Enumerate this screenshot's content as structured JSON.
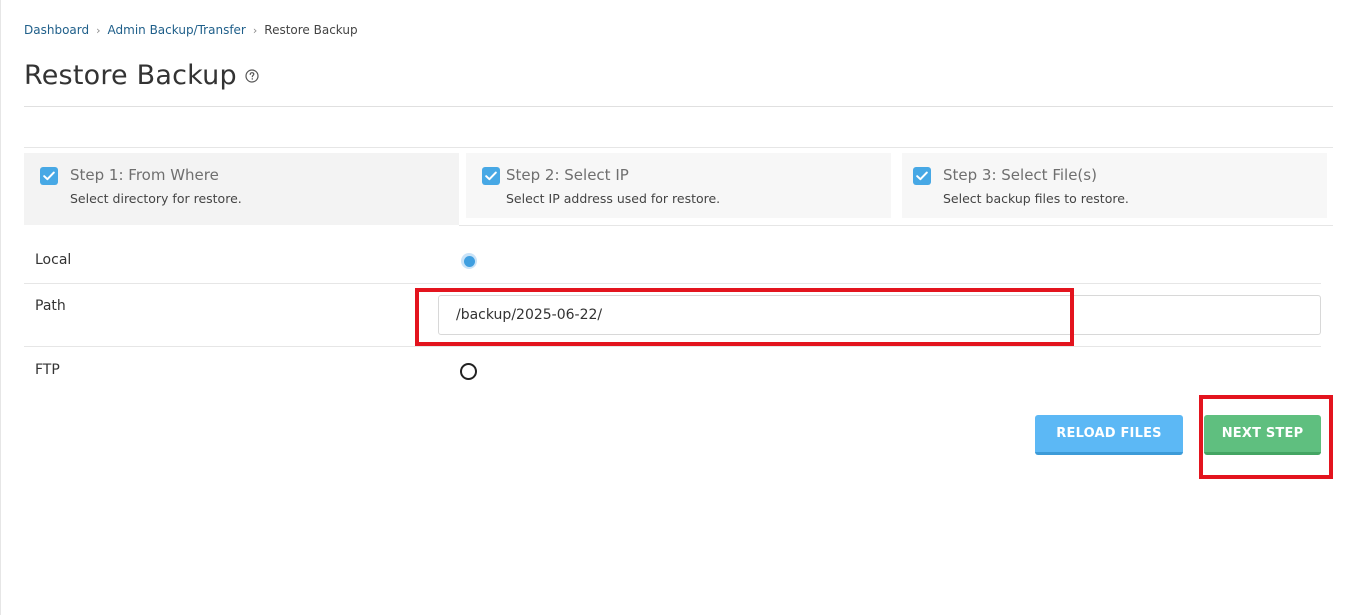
{
  "breadcrumb": {
    "items": [
      "Dashboard",
      "Admin Backup/Transfer",
      "Restore Backup"
    ],
    "separator": "›"
  },
  "page": {
    "title": "Restore Backup",
    "help_icon": "question-circle-icon"
  },
  "steps": [
    {
      "title": "Step 1: From Where",
      "description": "Select directory for restore.",
      "checked": true,
      "active": true
    },
    {
      "title": "Step 2: Select IP",
      "description": "Select IP address used for restore.",
      "checked": true,
      "active": false
    },
    {
      "title": "Step 3: Select File(s)",
      "description": "Select backup files to restore.",
      "checked": true,
      "active": false
    }
  ],
  "form": {
    "local_label": "Local",
    "local_selected": true,
    "path_label": "Path",
    "path_value": "/backup/2025-06-22/",
    "ftp_label": "FTP",
    "ftp_selected": false
  },
  "buttons": {
    "reload_label": "RELOAD FILES",
    "next_label": "NEXT STEP"
  },
  "colors": {
    "accent_blue": "#47a8e5",
    "reload_button": "#5cb8f5",
    "next_button": "#5fbf7f",
    "highlight": "#e3141e",
    "breadcrumb_link": "#1f5f8a"
  }
}
